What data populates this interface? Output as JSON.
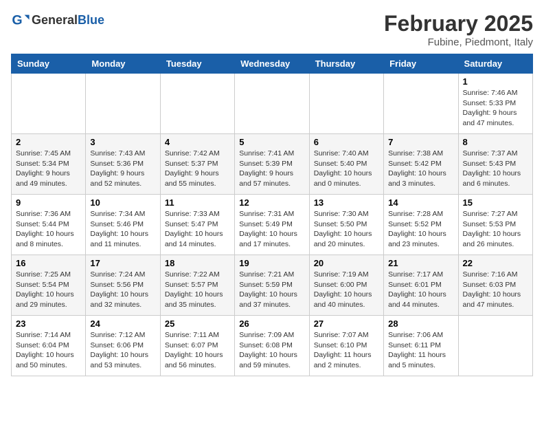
{
  "header": {
    "logo_general": "General",
    "logo_blue": "Blue",
    "month_title": "February 2025",
    "subtitle": "Fubine, Piedmont, Italy"
  },
  "weekdays": [
    "Sunday",
    "Monday",
    "Tuesday",
    "Wednesday",
    "Thursday",
    "Friday",
    "Saturday"
  ],
  "weeks": [
    [
      {
        "day": "",
        "info": ""
      },
      {
        "day": "",
        "info": ""
      },
      {
        "day": "",
        "info": ""
      },
      {
        "day": "",
        "info": ""
      },
      {
        "day": "",
        "info": ""
      },
      {
        "day": "",
        "info": ""
      },
      {
        "day": "1",
        "info": "Sunrise: 7:46 AM\nSunset: 5:33 PM\nDaylight: 9 hours\nand 47 minutes."
      }
    ],
    [
      {
        "day": "2",
        "info": "Sunrise: 7:45 AM\nSunset: 5:34 PM\nDaylight: 9 hours\nand 49 minutes."
      },
      {
        "day": "3",
        "info": "Sunrise: 7:43 AM\nSunset: 5:36 PM\nDaylight: 9 hours\nand 52 minutes."
      },
      {
        "day": "4",
        "info": "Sunrise: 7:42 AM\nSunset: 5:37 PM\nDaylight: 9 hours\nand 55 minutes."
      },
      {
        "day": "5",
        "info": "Sunrise: 7:41 AM\nSunset: 5:39 PM\nDaylight: 9 hours\nand 57 minutes."
      },
      {
        "day": "6",
        "info": "Sunrise: 7:40 AM\nSunset: 5:40 PM\nDaylight: 10 hours\nand 0 minutes."
      },
      {
        "day": "7",
        "info": "Sunrise: 7:38 AM\nSunset: 5:42 PM\nDaylight: 10 hours\nand 3 minutes."
      },
      {
        "day": "8",
        "info": "Sunrise: 7:37 AM\nSunset: 5:43 PM\nDaylight: 10 hours\nand 6 minutes."
      }
    ],
    [
      {
        "day": "9",
        "info": "Sunrise: 7:36 AM\nSunset: 5:44 PM\nDaylight: 10 hours\nand 8 minutes."
      },
      {
        "day": "10",
        "info": "Sunrise: 7:34 AM\nSunset: 5:46 PM\nDaylight: 10 hours\nand 11 minutes."
      },
      {
        "day": "11",
        "info": "Sunrise: 7:33 AM\nSunset: 5:47 PM\nDaylight: 10 hours\nand 14 minutes."
      },
      {
        "day": "12",
        "info": "Sunrise: 7:31 AM\nSunset: 5:49 PM\nDaylight: 10 hours\nand 17 minutes."
      },
      {
        "day": "13",
        "info": "Sunrise: 7:30 AM\nSunset: 5:50 PM\nDaylight: 10 hours\nand 20 minutes."
      },
      {
        "day": "14",
        "info": "Sunrise: 7:28 AM\nSunset: 5:52 PM\nDaylight: 10 hours\nand 23 minutes."
      },
      {
        "day": "15",
        "info": "Sunrise: 7:27 AM\nSunset: 5:53 PM\nDaylight: 10 hours\nand 26 minutes."
      }
    ],
    [
      {
        "day": "16",
        "info": "Sunrise: 7:25 AM\nSunset: 5:54 PM\nDaylight: 10 hours\nand 29 minutes."
      },
      {
        "day": "17",
        "info": "Sunrise: 7:24 AM\nSunset: 5:56 PM\nDaylight: 10 hours\nand 32 minutes."
      },
      {
        "day": "18",
        "info": "Sunrise: 7:22 AM\nSunset: 5:57 PM\nDaylight: 10 hours\nand 35 minutes."
      },
      {
        "day": "19",
        "info": "Sunrise: 7:21 AM\nSunset: 5:59 PM\nDaylight: 10 hours\nand 37 minutes."
      },
      {
        "day": "20",
        "info": "Sunrise: 7:19 AM\nSunset: 6:00 PM\nDaylight: 10 hours\nand 40 minutes."
      },
      {
        "day": "21",
        "info": "Sunrise: 7:17 AM\nSunset: 6:01 PM\nDaylight: 10 hours\nand 44 minutes."
      },
      {
        "day": "22",
        "info": "Sunrise: 7:16 AM\nSunset: 6:03 PM\nDaylight: 10 hours\nand 47 minutes."
      }
    ],
    [
      {
        "day": "23",
        "info": "Sunrise: 7:14 AM\nSunset: 6:04 PM\nDaylight: 10 hours\nand 50 minutes."
      },
      {
        "day": "24",
        "info": "Sunrise: 7:12 AM\nSunset: 6:06 PM\nDaylight: 10 hours\nand 53 minutes."
      },
      {
        "day": "25",
        "info": "Sunrise: 7:11 AM\nSunset: 6:07 PM\nDaylight: 10 hours\nand 56 minutes."
      },
      {
        "day": "26",
        "info": "Sunrise: 7:09 AM\nSunset: 6:08 PM\nDaylight: 10 hours\nand 59 minutes."
      },
      {
        "day": "27",
        "info": "Sunrise: 7:07 AM\nSunset: 6:10 PM\nDaylight: 11 hours\nand 2 minutes."
      },
      {
        "day": "28",
        "info": "Sunrise: 7:06 AM\nSunset: 6:11 PM\nDaylight: 11 hours\nand 5 minutes."
      },
      {
        "day": "",
        "info": ""
      }
    ]
  ]
}
